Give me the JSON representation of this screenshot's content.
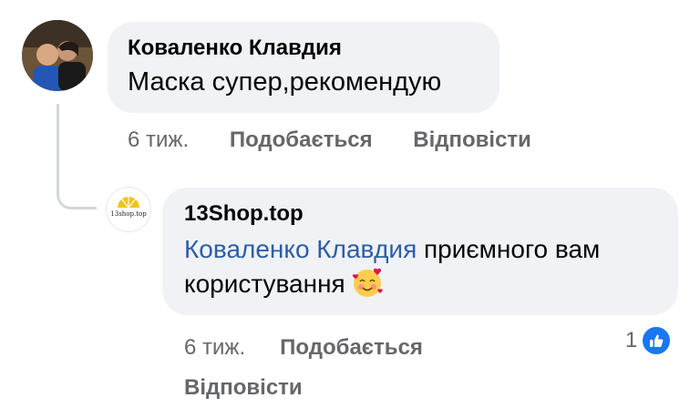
{
  "comment": {
    "author": "Коваленко Клавдия",
    "text": "Маска супер,рекомендую",
    "time": "6 тиж.",
    "like_label": "Подобається",
    "reply_label": "Відповісти"
  },
  "reply": {
    "author": "13Shop.top",
    "mention": "Коваленко Клавдия",
    "text": " приємного вам користування",
    "avatar_logo_text": "13shop.top",
    "time": "6 тиж.",
    "like_label": "Подобається",
    "reply_label": "Відповісти",
    "reaction_count": "1",
    "reaction_icon": "thumbs-up-icon",
    "emoji": "smiling-face-with-hearts-icon"
  },
  "colors": {
    "bubble": "#f0f2f5",
    "mention": "#2c5ea8",
    "meta": "#65676b",
    "like_blue": "#1877f2"
  }
}
